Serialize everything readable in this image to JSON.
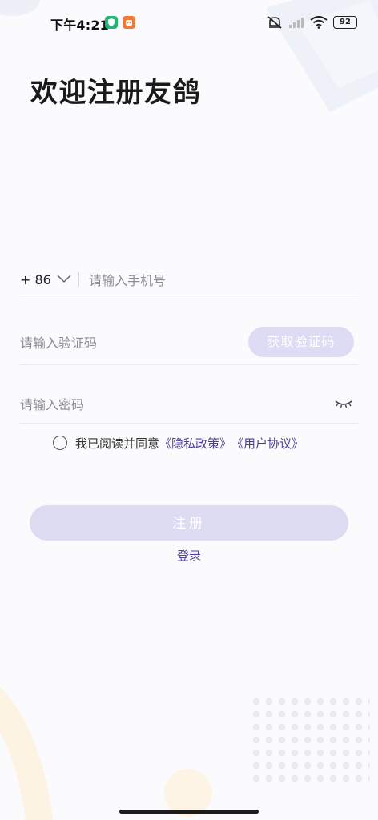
{
  "status_bar": {
    "time": "下午4:21",
    "battery": "92",
    "icons": [
      "shield-icon",
      "app-icon",
      "mute-icon",
      "signal-icon",
      "wifi-icon",
      "battery-icon"
    ]
  },
  "header": {
    "title": "欢迎注册友鸽"
  },
  "form": {
    "country_code": "+ 86",
    "phone_placeholder": "请输入手机号",
    "code_placeholder": "请输入验证码",
    "get_code_label": "获取验证码",
    "password_placeholder": "请输入密码"
  },
  "agreement": {
    "prefix": "我已阅读并同意",
    "privacy_label": "《隐私政策》",
    "terms_label": "《用户协议》"
  },
  "actions": {
    "register_label": "注册",
    "login_label": "登录"
  },
  "colors": {
    "accent": "#4b3f9a",
    "button_disabled": "#dedcf2",
    "background": "#fbfbfd"
  }
}
